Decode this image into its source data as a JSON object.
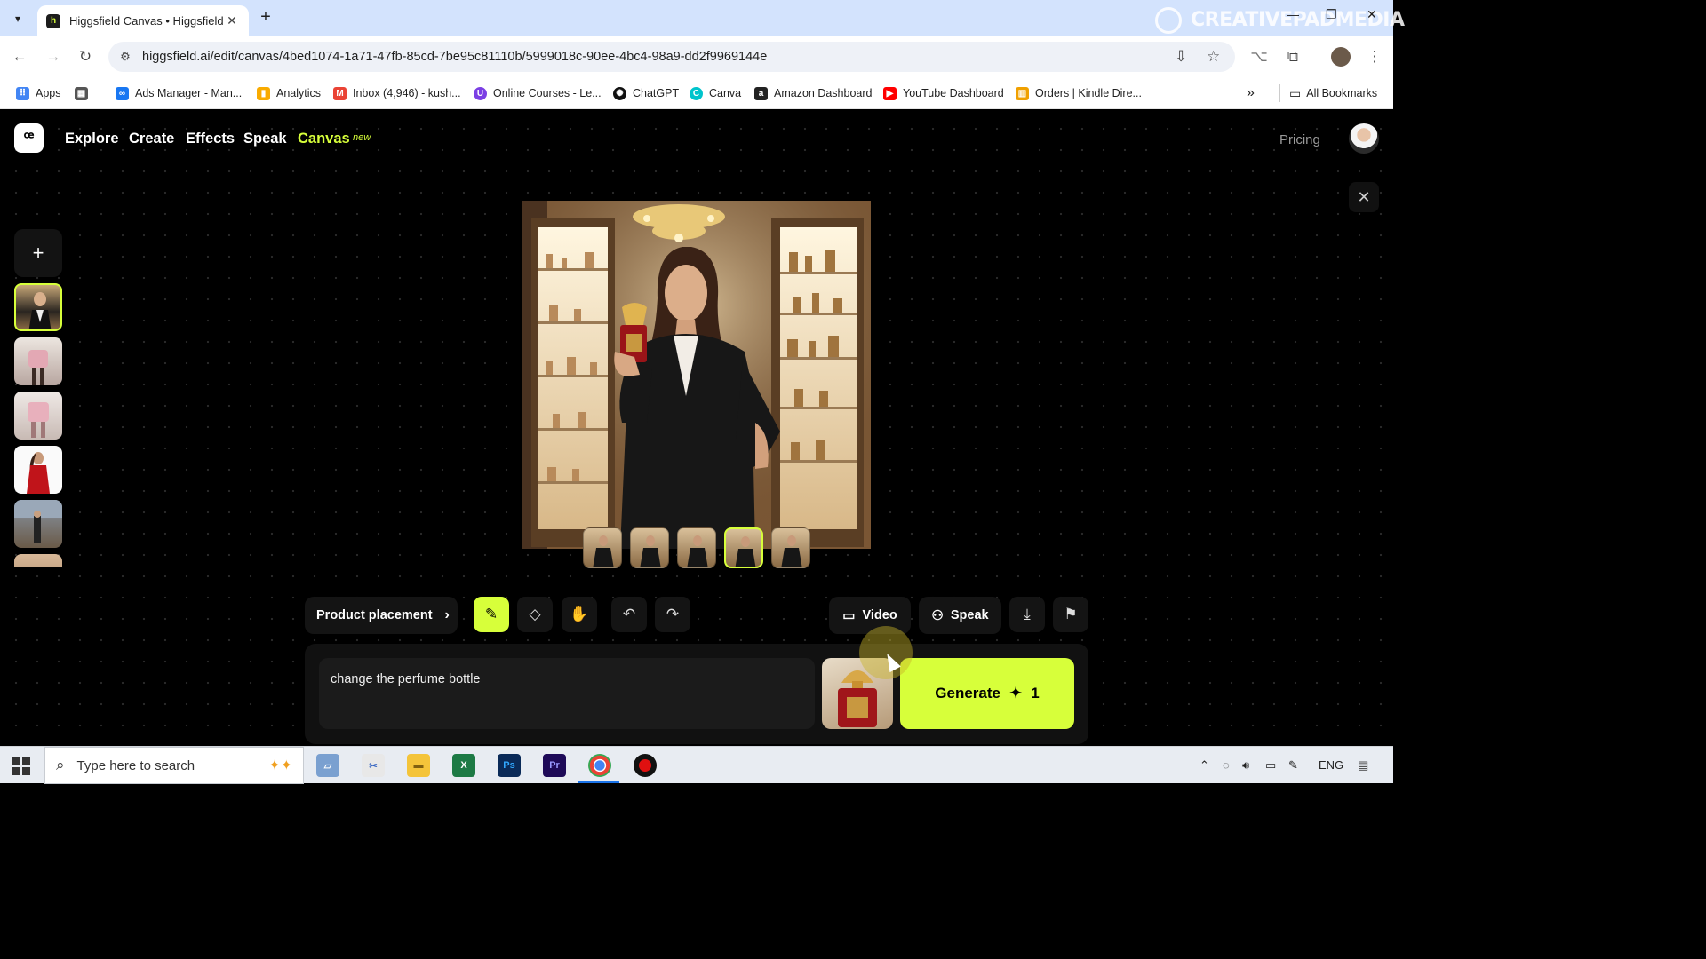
{
  "browser": {
    "tab_title": "Higgsfield Canvas • Higgsfield",
    "url": "higgsfield.ai/edit/canvas/4bed1074-1a71-47fb-85cd-7be95c81110b/5999018c-90ee-4bc4-98a9-dd2f9969144e",
    "watermark": "CREATIVEPADMEDIA",
    "bookmarks": [
      {
        "label": "Apps",
        "icon": "apps-grid-icon",
        "color": "#4285f4"
      },
      {
        "label": "",
        "icon": "tab-groups-icon",
        "color": "#555555"
      },
      {
        "label": "Ads Manager - Man...",
        "icon": "meta-icon",
        "color": "#1877f2"
      },
      {
        "label": "Analytics",
        "icon": "analytics-icon",
        "color": "#f9ab00"
      },
      {
        "label": "Inbox (4,946) - kush...",
        "icon": "gmail-icon",
        "color": "#ea4335"
      },
      {
        "label": "Online Courses - Le...",
        "icon": "courses-icon",
        "color": "#7b3fe4"
      },
      {
        "label": "ChatGPT",
        "icon": "chatgpt-icon",
        "color": "#111111"
      },
      {
        "label": "Canva",
        "icon": "canva-icon",
        "color": "#00c4cc"
      },
      {
        "label": "Amazon Dashboard",
        "icon": "amazon-icon",
        "color": "#222222"
      },
      {
        "label": "YouTube Dashboard",
        "icon": "youtube-icon",
        "color": "#ff0000"
      },
      {
        "label": "Orders | Kindle Dire...",
        "icon": "kindle-icon",
        "color": "#f0a000"
      }
    ],
    "all_bookmarks": "All Bookmarks"
  },
  "app": {
    "nav": {
      "explore": "Explore",
      "create": "Create",
      "effects": "Effects",
      "speak": "Speak",
      "canvas": "Canvas",
      "new_badge": "new",
      "pricing": "Pricing"
    },
    "accent_color": "#d7ff3a",
    "toolbar": {
      "product_placement": "Product placement",
      "video": "Video",
      "speak": "Speak"
    },
    "prompt": {
      "value": "change the perfume bottle"
    },
    "generate": {
      "label": "Generate",
      "credits": "1"
    }
  },
  "taskbar": {
    "search_placeholder": "Type here to search",
    "language": "ENG"
  }
}
